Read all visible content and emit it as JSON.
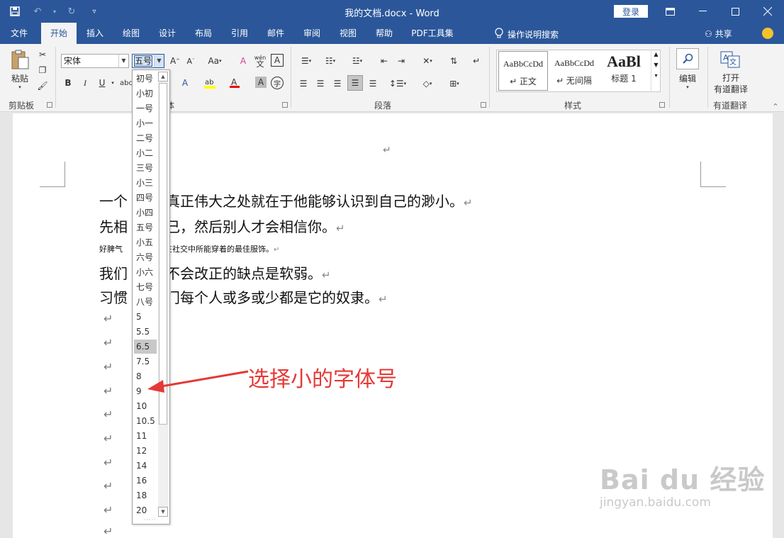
{
  "window": {
    "title": "我的文档.docx  -  Word",
    "login": "登录"
  },
  "qat": {
    "save_icon": "save-icon",
    "undo_icon": "undo-icon",
    "redo_icon": "redo-icon",
    "customize_icon": "customize-icon"
  },
  "tabs": [
    {
      "label": "文件"
    },
    {
      "label": "开始"
    },
    {
      "label": "插入"
    },
    {
      "label": "绘图"
    },
    {
      "label": "设计"
    },
    {
      "label": "布局"
    },
    {
      "label": "引用"
    },
    {
      "label": "邮件"
    },
    {
      "label": "审阅"
    },
    {
      "label": "视图"
    },
    {
      "label": "帮助"
    },
    {
      "label": "PDF工具集"
    }
  ],
  "search_hint": "操作说明搜索",
  "share": "共享",
  "ribbon": {
    "clipboard": {
      "label": "剪贴板",
      "paste": "粘贴"
    },
    "font": {
      "label": "体",
      "font_name": "宋体",
      "font_size": "五号",
      "aa_label": "Aa",
      "phonetic": "wén"
    },
    "paragraph": {
      "label": "段落"
    },
    "styles": {
      "label": "样式",
      "items": [
        {
          "preview": "AaBbCcDd",
          "name": "↵ 正文"
        },
        {
          "preview": "AaBbCcDd",
          "name": "↵ 无间隔"
        },
        {
          "preview": "AaBl",
          "name": "标题 1"
        }
      ]
    },
    "editing": {
      "label": "编辑"
    },
    "translate": {
      "line1": "打开",
      "line2": "有道翻译",
      "group": "有道翻译"
    }
  },
  "document": {
    "lines": [
      {
        "text": "一个",
        "rest": "真正伟大之处就在于他能够认识到自己的渺小。"
      },
      {
        "text": "先相",
        "rest": "己，然后别人才会相信你。"
      },
      {
        "text": "好脾气",
        "rest": "在社交中所能穿着的最佳服饰。"
      },
      {
        "text": "我们",
        "rest": "不会改正的缺点是软弱。"
      },
      {
        "text": "习惯",
        "rest": "门每个人或多或少都是它的奴隶。"
      }
    ],
    "para_mark": "↵"
  },
  "font_size_dropdown": {
    "items": [
      "初号",
      "小初",
      "一号",
      "小一",
      "二号",
      "小二",
      "三号",
      "小三",
      "四号",
      "小四",
      "五号",
      "小五",
      "六号",
      "小六",
      "七号",
      "八号",
      "5",
      "5.5",
      "6.5",
      "7.5",
      "8",
      "9",
      "10",
      "10.5",
      "11",
      "12",
      "14",
      "16",
      "18",
      "20"
    ],
    "highlighted": "6.5"
  },
  "annotation": {
    "text": "选择小的字体号"
  },
  "watermark": {
    "brand": "Bai du 经验",
    "url": "jingyan.baidu.com"
  }
}
